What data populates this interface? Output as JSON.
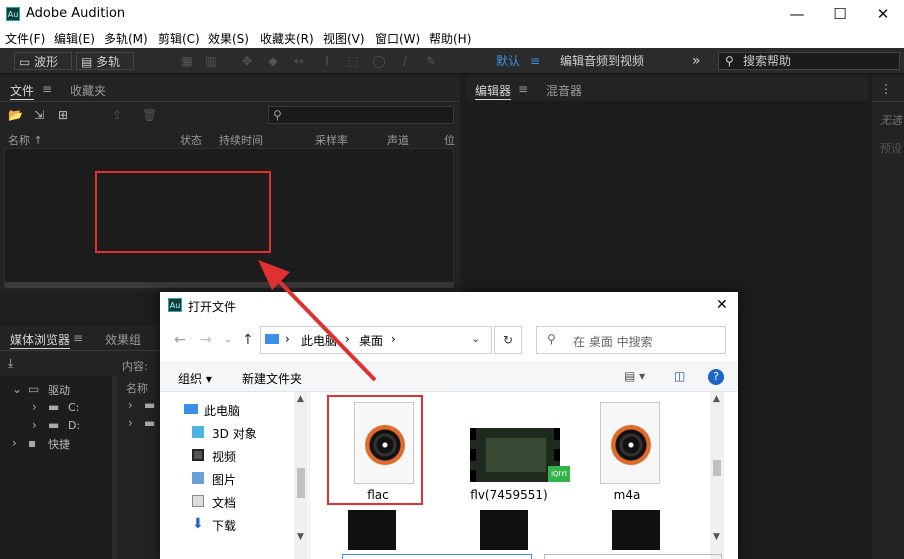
{
  "app": {
    "title": "Adobe Audition",
    "icon_text": "Au",
    "window_controls": {
      "minimize": "—",
      "maximize": "☐",
      "close": "✕"
    }
  },
  "menu": [
    "文件(F)",
    "编辑(E)",
    "多轨(M)",
    "剪辑(C)",
    "效果(S)",
    "收藏夹(R)",
    "视图(V)",
    "窗口(W)",
    "帮助(H)"
  ],
  "toolbar": {
    "waveform": "波形",
    "multitrack": "多轨",
    "workspace_default": "默认",
    "workspace_edit_video": "编辑音频到视频",
    "overflow": "»",
    "help_search_placeholder": "搜索帮助"
  },
  "files_panel": {
    "tab_files": "文件",
    "tab_favorites": "收藏夹",
    "columns": [
      "名称 ↑",
      "状态",
      "持续时间",
      "采样率",
      "声道",
      "位"
    ]
  },
  "editor_panel": {
    "tab_editor": "编辑器",
    "tab_mixer": "混音器"
  },
  "right_panel": {
    "no_selection": "无选",
    "preset": "预设"
  },
  "media_panel": {
    "tab_browser": "媒体浏览器",
    "tab_effects": "效果组",
    "content_label": "内容:",
    "name_header": "名称",
    "tree": [
      "驱动",
      "C:",
      "D:",
      "快捷"
    ]
  },
  "dialog": {
    "icon_text": "Au",
    "title": "打开文件",
    "breadcrumb": [
      "此电脑",
      "桌面"
    ],
    "search_placeholder": "在 桌面 中搜索",
    "organize": "组织 ▾",
    "new_folder": "新建文件夹",
    "nav": [
      "此电脑",
      "3D 对象",
      "视频",
      "图片",
      "文档",
      "下载"
    ],
    "files": [
      {
        "name": "flac",
        "kind": "audio"
      },
      {
        "name": "flv(7459551)",
        "kind": "video",
        "badge": "iQIYI"
      },
      {
        "name": "m4a",
        "kind": "audio"
      }
    ],
    "close": "✕",
    "help": "?"
  },
  "colors": {
    "annotation": "#e03030",
    "accent": "#3f8fe0"
  }
}
